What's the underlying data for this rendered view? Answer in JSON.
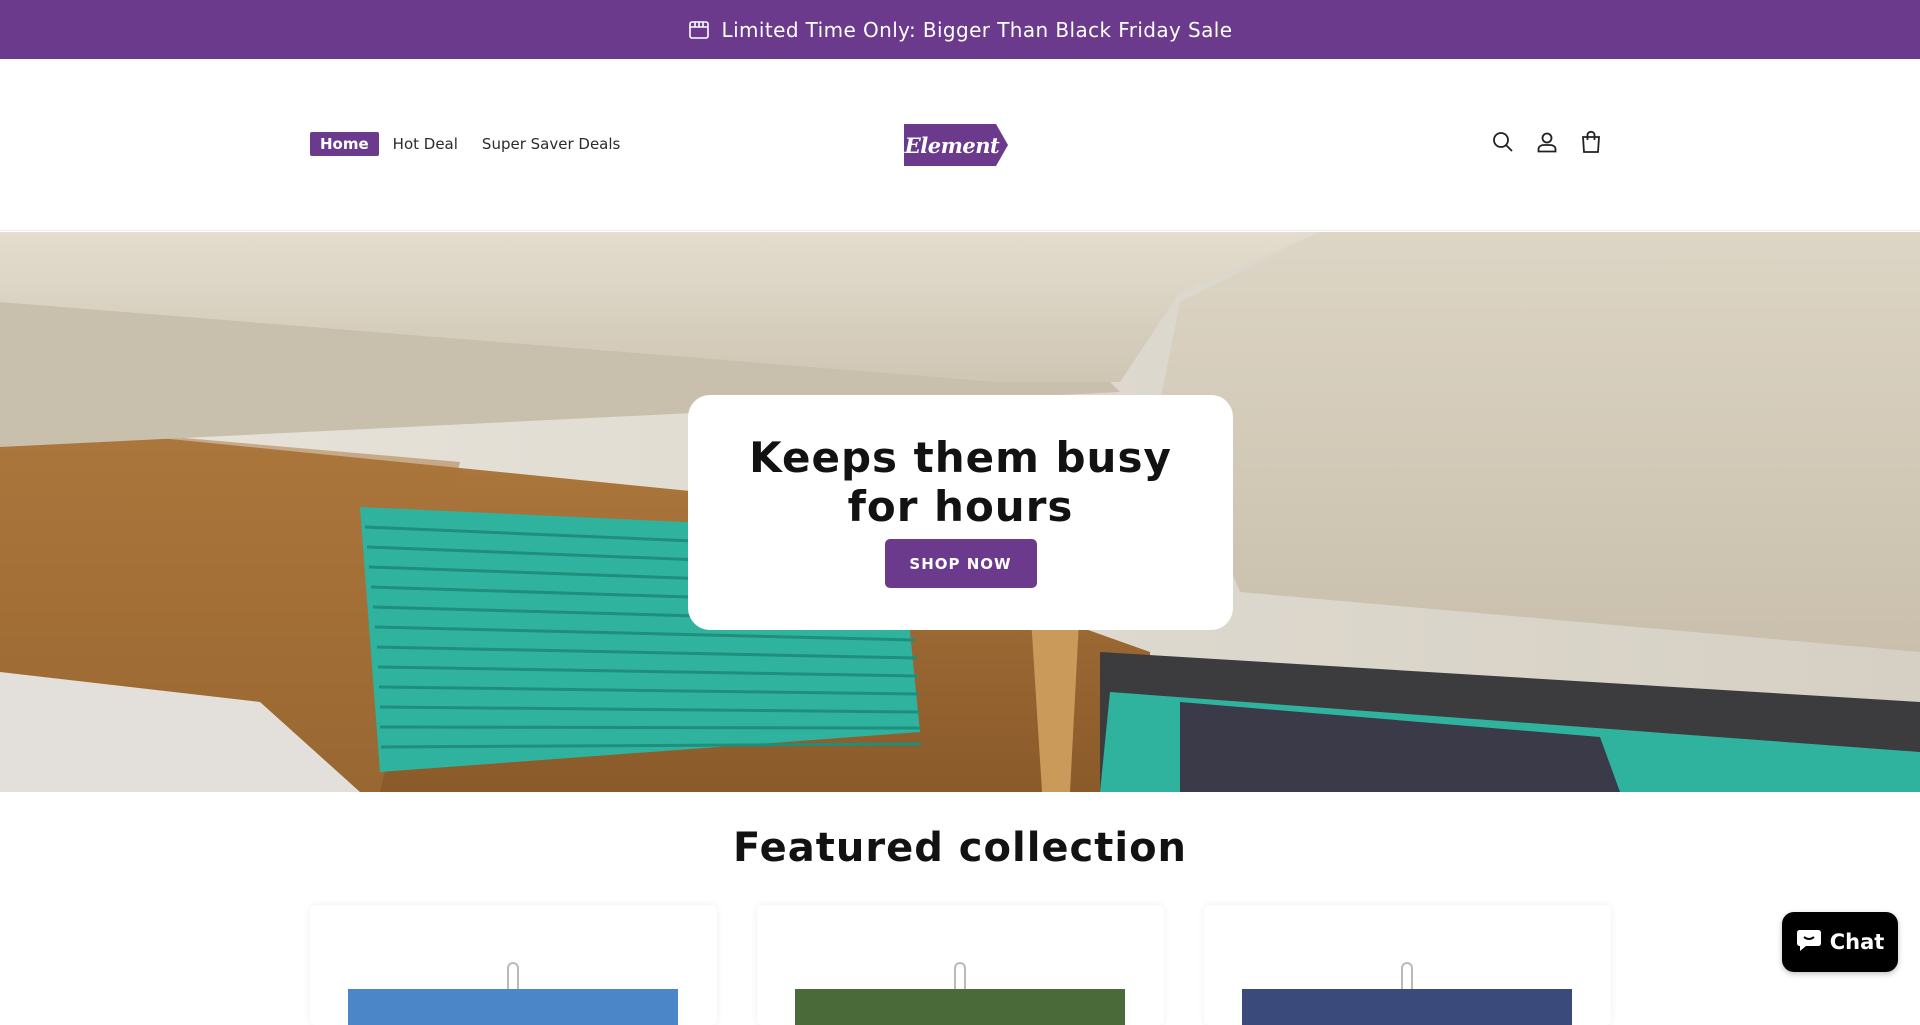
{
  "announcement": {
    "text": "Limited Time Only: Bigger Than Black Friday Sale",
    "icon": "store-icon"
  },
  "header": {
    "nav": [
      {
        "label": "Home",
        "active": true
      },
      {
        "label": "Hot Deal",
        "active": false
      },
      {
        "label": "Super Saver Deals",
        "active": false
      }
    ],
    "logo_text": "Element",
    "icons": [
      "search-icon",
      "account-icon",
      "cart-icon"
    ]
  },
  "hero": {
    "title": "Keeps them busy for hours",
    "button_label": "SHOP NOW"
  },
  "featured": {
    "title": "Featured collection",
    "cards": [
      {
        "poster_color": "#4a86c8"
      },
      {
        "poster_color": "#4b6a3a"
      },
      {
        "poster_color": "#3a4a7a"
      }
    ]
  },
  "chat": {
    "label": "Chat",
    "icon": "chat-bubble-icon"
  },
  "colors": {
    "brand": "#6b3a8c",
    "chat_bg": "#000000"
  }
}
